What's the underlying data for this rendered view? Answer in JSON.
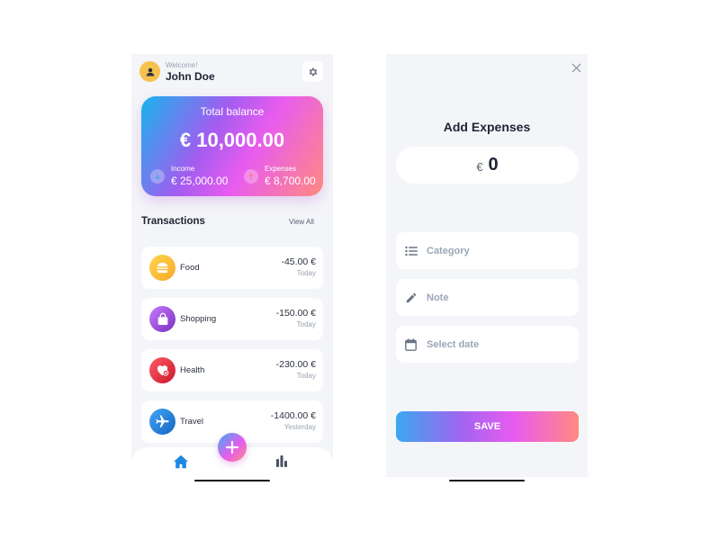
{
  "home": {
    "welcome": "Welcome!",
    "user_name": "John Doe",
    "balance_card": {
      "title": "Total balance",
      "amount": "€ 10,000.00",
      "income_label": "Income",
      "income_value": "€ 25,000.00",
      "expenses_label": "Expenses",
      "expenses_value": "€ 8,700.00"
    },
    "transactions_title": "Transactions",
    "view_all": "View All",
    "transactions": [
      {
        "name": "Food",
        "amount": "-45.00 €",
        "date": "Today",
        "icon": "burger-icon",
        "color": "#f7b731"
      },
      {
        "name": "Shopping",
        "amount": "-150.00 €",
        "date": "Today",
        "icon": "shopping-bag-icon",
        "color": "#9b51e0"
      },
      {
        "name": "Health",
        "amount": "-230.00 €",
        "date": "Today",
        "icon": "heart-plus-icon",
        "color": "#e53945"
      },
      {
        "name": "Travel",
        "amount": "-1400.00 €",
        "date": "Yesterday",
        "icon": "airplane-icon",
        "color": "#1e88e5"
      }
    ],
    "nav": {
      "home_icon": "home-icon",
      "stats_icon": "bar-chart-icon",
      "add_icon": "plus-icon"
    }
  },
  "add_expense": {
    "title": "Add Expenses",
    "currency": "€",
    "amount": "0",
    "fields": [
      {
        "placeholder": "Category",
        "icon": "list-icon"
      },
      {
        "placeholder": "Note",
        "icon": "pencil-icon"
      },
      {
        "placeholder": "Select date",
        "icon": "calendar-icon"
      }
    ],
    "save_label": "SAVE",
    "close_icon": "close-icon"
  },
  "colors": {
    "accent_blue": "#1e88e5",
    "gradient_start": "#18b4ec",
    "gradient_mid": "#e85cef",
    "gradient_end": "#ff8a80",
    "background": "#f4f5f8"
  }
}
